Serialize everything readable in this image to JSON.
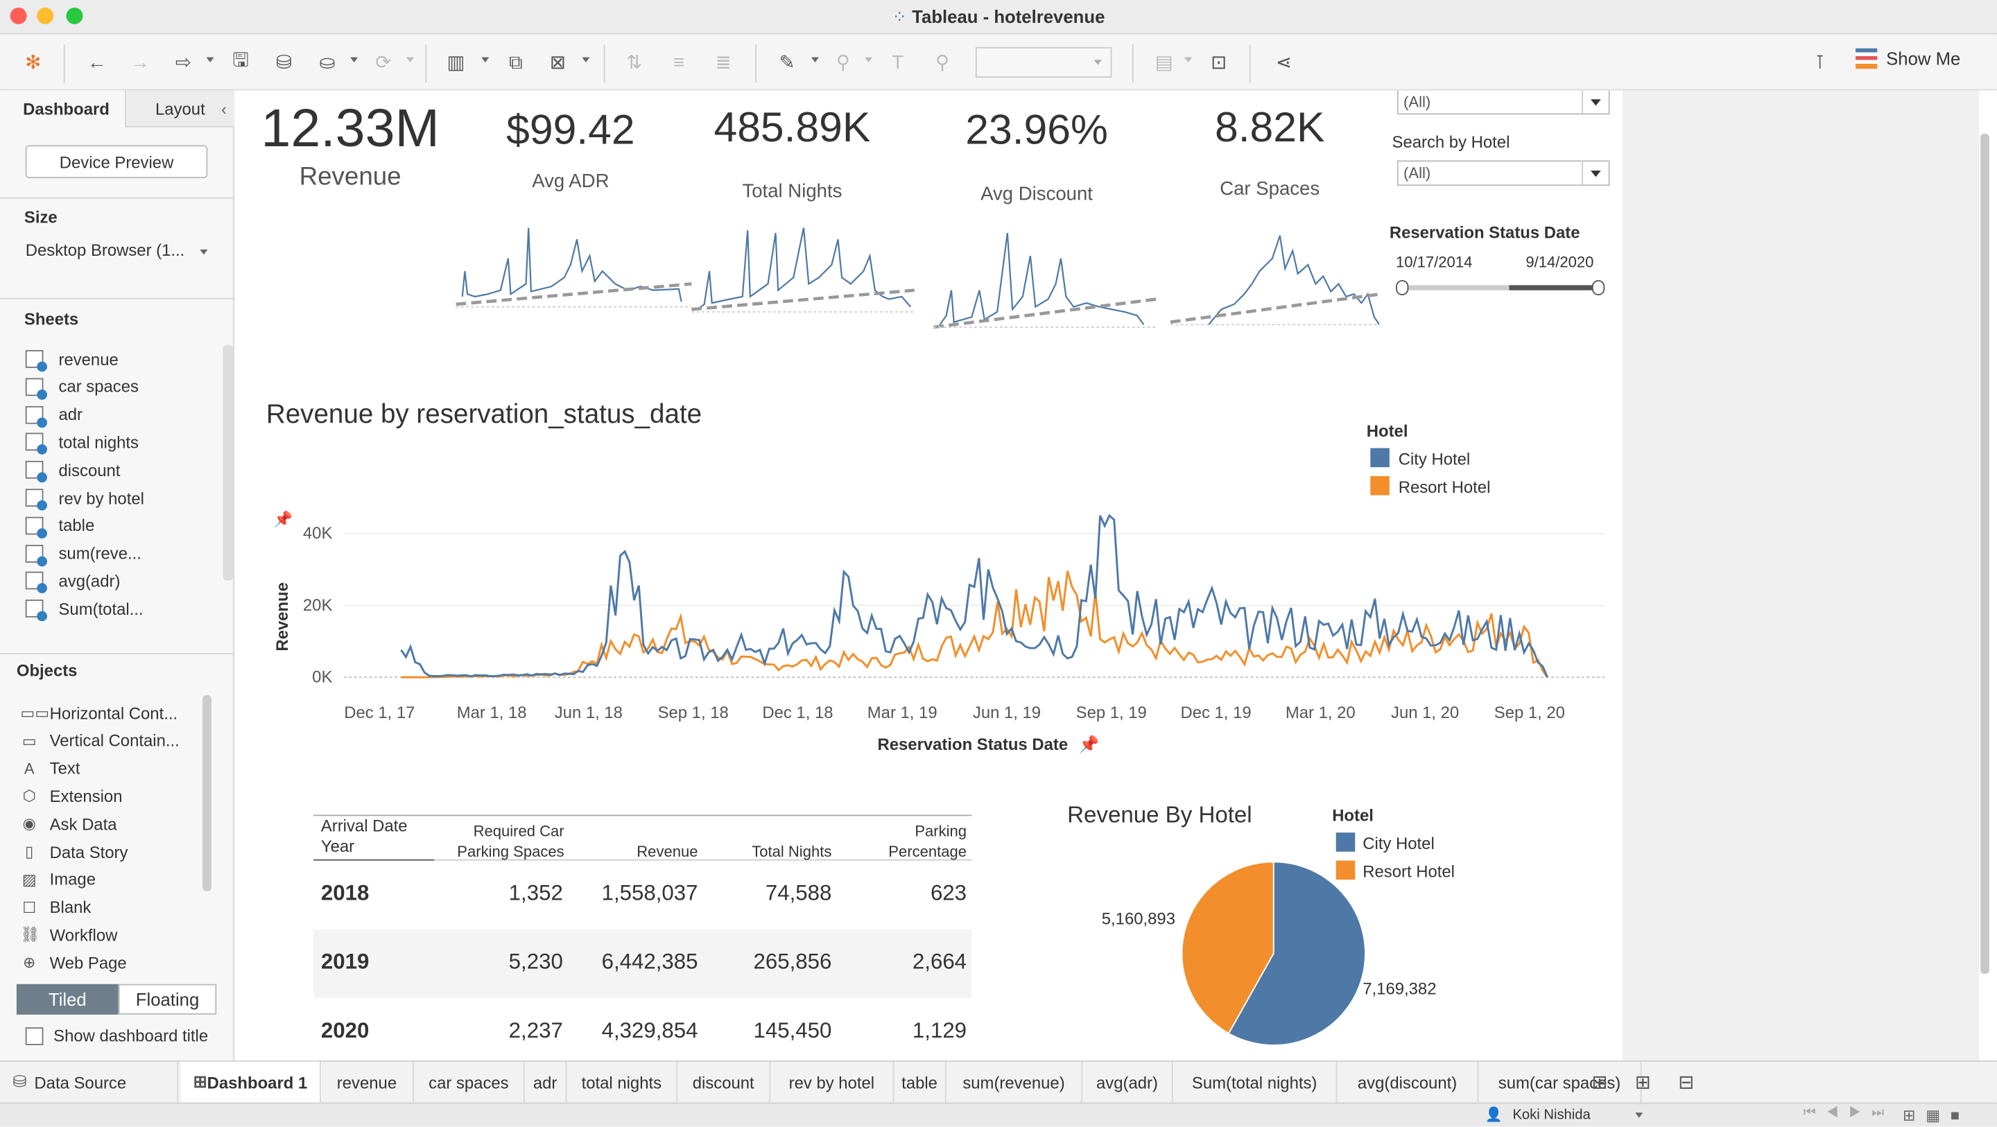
{
  "window": {
    "title": "Tableau - hotelrevenue"
  },
  "toolbar": {
    "show_me": "Show Me"
  },
  "left_panel": {
    "tab_dashboard": "Dashboard",
    "tab_layout": "Layout",
    "device_preview": "Device Preview",
    "size_label": "Size",
    "size_value": "Desktop Browser (1...",
    "sheets_label": "Sheets",
    "sheets": [
      "revenue",
      "car spaces",
      "adr",
      "total nights",
      "discount",
      "rev by hotel",
      "table",
      "sum(reve...",
      "avg(adr)",
      "Sum(total..."
    ],
    "objects_label": "Objects",
    "objects": [
      "Horizontal Cont...",
      "Vertical Contain...",
      "Text",
      "Extension",
      "Ask Data",
      "Data Story",
      "Image",
      "Blank",
      "Workflow",
      "Web Page"
    ],
    "tiled": "Tiled",
    "floating": "Floating",
    "show_title": "Show dashboard title"
  },
  "kpis": [
    {
      "value": "12.33M",
      "label": "Revenue"
    },
    {
      "value": "$99.42",
      "label": "Avg ADR"
    },
    {
      "value": "485.89K",
      "label": "Total Nights"
    },
    {
      "value": "23.96%",
      "label": "Avg Discount"
    },
    {
      "value": "8.82K",
      "label": "Car Spaces"
    }
  ],
  "filters": {
    "top_value": "(All)",
    "search_hotel_label": "Search by Hotel",
    "search_hotel_value": "(All)",
    "status_date_label": "Reservation Status Date",
    "date_start": "10/17/2014",
    "date_end": "9/14/2020"
  },
  "line_chart": {
    "title": "Revenue by reservation_status_date"
  },
  "legend": {
    "title": "Hotel",
    "items": [
      {
        "name": "City Hotel",
        "color": "#4e79a7"
      },
      {
        "name": "Resort Hotel",
        "color": "#f28e2b"
      }
    ]
  },
  "chart_data": [
    {
      "type": "line",
      "title": "Revenue by reservation_status_date",
      "xlabel": "Reservation Status Date",
      "ylabel": "Revenue",
      "x_ticks": [
        "Dec 1, 17",
        "Mar 1, 18",
        "Jun 1, 18",
        "Sep 1, 18",
        "Dec 1, 18",
        "Mar 1, 19",
        "Jun 1, 19",
        "Sep 1, 19",
        "Dec 1, 19",
        "Mar 1, 20",
        "Jun 1, 20",
        "Sep 1, 20"
      ],
      "y_ticks": [
        "0K",
        "20K",
        "40K"
      ],
      "ylim": [
        0,
        45000
      ],
      "legend": "top-right",
      "series": [
        {
          "name": "City Hotel",
          "color": "#4e79a7",
          "values": [
            9000,
            300,
            500,
            400,
            600,
            800,
            1200,
            3000,
            35000,
            6000,
            8000,
            7000,
            9000,
            5000,
            12000,
            6000,
            28000,
            10000,
            8000,
            21000,
            12000,
            30000,
            14000,
            12000,
            9000,
            45000,
            20000,
            15000,
            16000,
            19000,
            14000,
            13000,
            15000,
            12000,
            14000,
            16000,
            13000,
            15000,
            13000,
            12000,
            14000,
            0
          ]
        },
        {
          "name": "Resort Hotel",
          "color": "#f28e2b",
          "values": [
            0,
            0,
            200,
            300,
            400,
            600,
            900,
            6000,
            9000,
            11000,
            12000,
            8000,
            5000,
            3000,
            4000,
            4000,
            5000,
            4000,
            6000,
            8000,
            9000,
            14000,
            22000,
            23000,
            21000,
            17000,
            10000,
            8000,
            5000,
            4000,
            6000,
            5000,
            7000,
            8000,
            7000,
            9000,
            10000,
            11000,
            12000,
            13000,
            14000,
            0
          ]
        }
      ]
    },
    {
      "type": "pie",
      "title": "Revenue By Hotel",
      "categories": [
        "City Hotel",
        "Resort Hotel"
      ],
      "values": [
        7169382,
        5160893
      ],
      "legend": "top-right"
    },
    {
      "type": "table",
      "columns": [
        "Arrival Date Year",
        "Required Car Parking Spaces",
        "Revenue",
        "Total Nights",
        "Parking Percentage"
      ],
      "rows": [
        [
          "2018",
          "1,352",
          "1,558,037",
          "74,588",
          "623"
        ],
        [
          "2019",
          "5,230",
          "6,442,385",
          "265,856",
          "2,664"
        ],
        [
          "2020",
          "2,237",
          "4,329,854",
          "145,450",
          "1,129"
        ]
      ]
    }
  ],
  "table": {
    "headers": {
      "year": [
        "Arrival Date",
        "Year"
      ],
      "parking": [
        "Required Car",
        "Parking Spaces"
      ],
      "revenue": "Revenue",
      "nights": "Total Nights",
      "pct": [
        "Parking",
        "Percentage"
      ]
    },
    "rows": [
      {
        "year": "2018",
        "parking": "1,352",
        "revenue": "1,558,037",
        "nights": "74,588",
        "pct": "623"
      },
      {
        "year": "2019",
        "parking": "5,230",
        "revenue": "6,442,385",
        "nights": "265,856",
        "pct": "2,664"
      },
      {
        "year": "2020",
        "parking": "2,237",
        "revenue": "4,329,854",
        "nights": "145,450",
        "pct": "1,129"
      }
    ]
  },
  "pie": {
    "title": "Revenue By Hotel",
    "label_resort": "5,160,893",
    "label_city": "7,169,382"
  },
  "sheet_tabs": {
    "data_source": "Data Source",
    "tabs": [
      "Dashboard 1",
      "revenue",
      "car spaces",
      "adr",
      "total nights",
      "discount",
      "rev by hotel",
      "table",
      "sum(revenue)",
      "avg(adr)",
      "Sum(total nights)",
      "avg(discount)",
      "sum(car spaces)"
    ]
  },
  "status": {
    "user": "Koki Nishida"
  }
}
